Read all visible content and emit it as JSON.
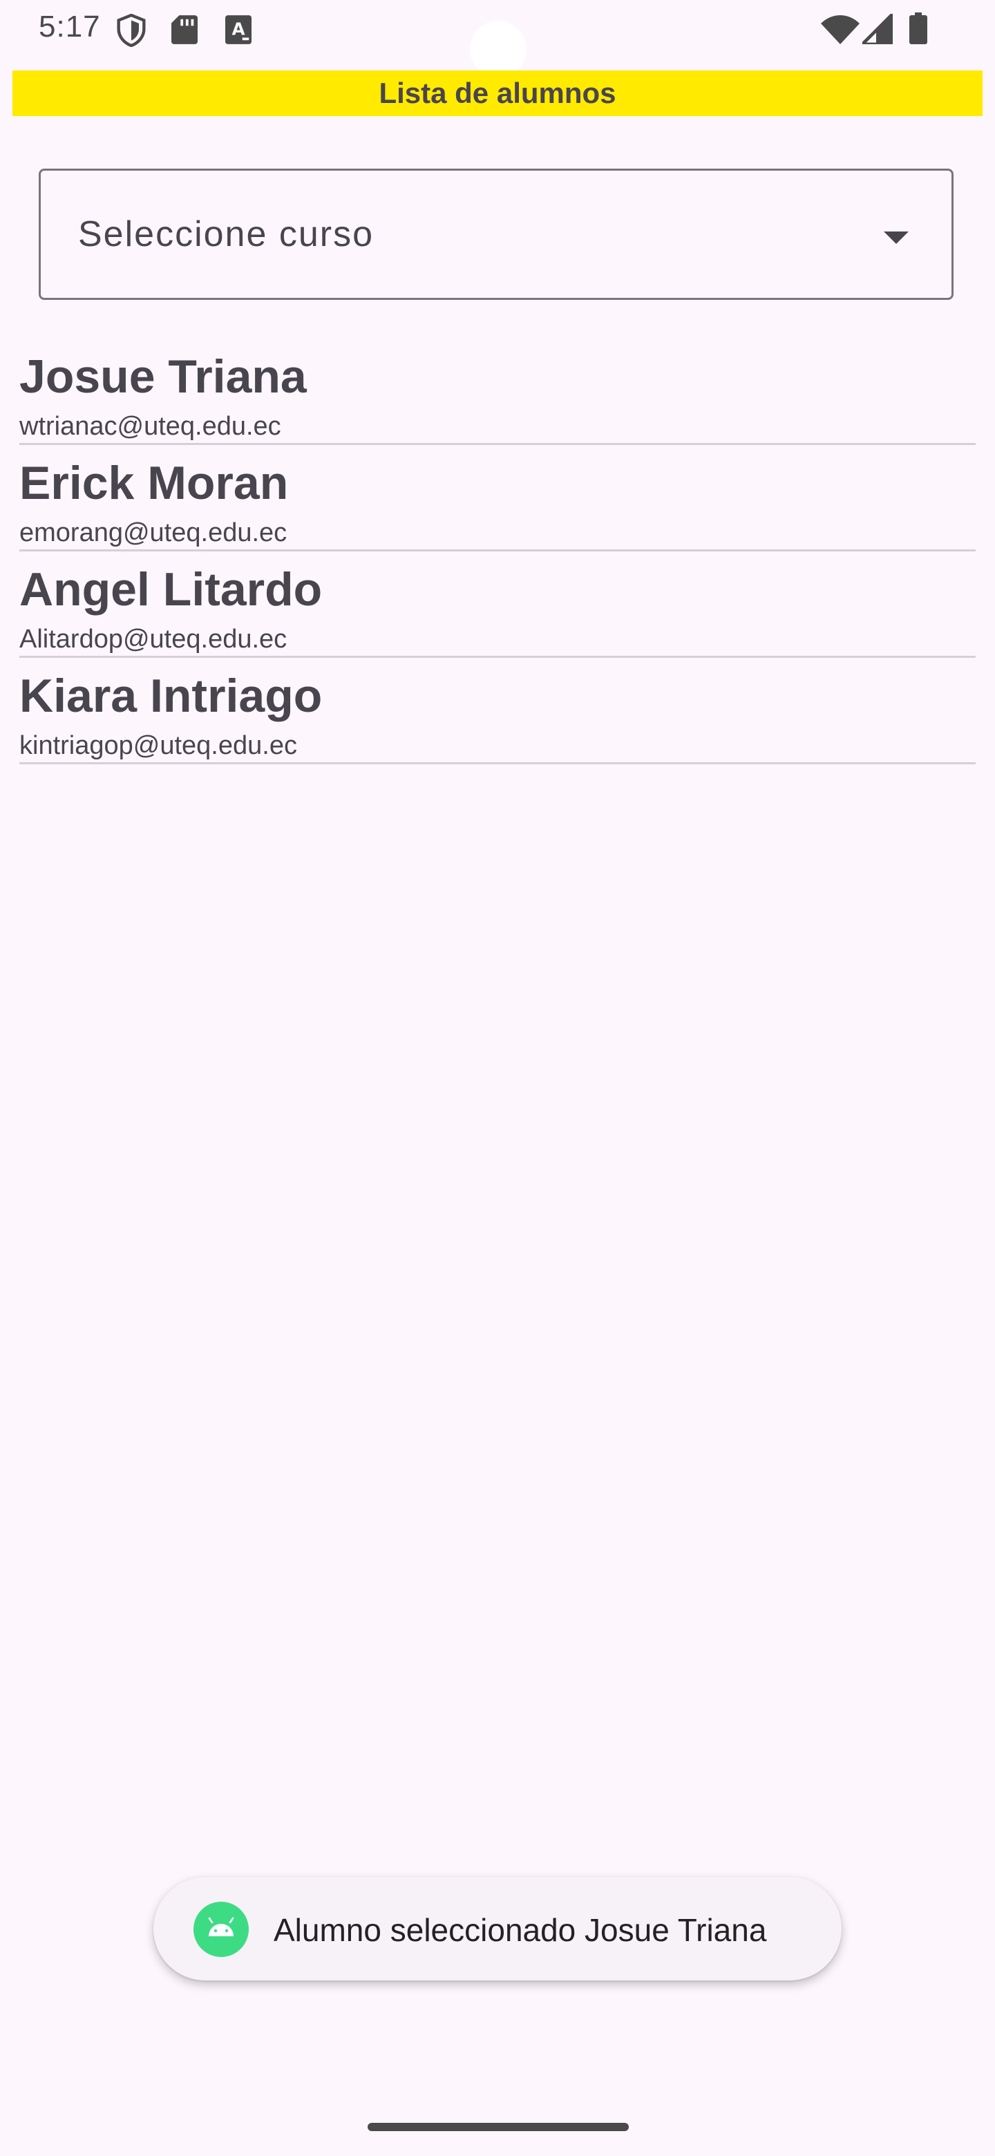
{
  "status_bar": {
    "time": "5:17",
    "left_icons": [
      "shield-icon",
      "sd-card-icon",
      "a-text-icon"
    ],
    "right_icons": [
      "wifi-icon",
      "signal-icon",
      "battery-icon"
    ]
  },
  "header": {
    "title": "Lista de alumnos",
    "background_color": "#ffea00"
  },
  "course_select": {
    "label": "Seleccione curso"
  },
  "students": [
    {
      "name": "Josue Triana",
      "email": "wtrianac@uteq.edu.ec"
    },
    {
      "name": "Erick Moran",
      "email": "emorang@uteq.edu.ec"
    },
    {
      "name": "Angel Litardo",
      "email": "Alitardop@uteq.edu.ec"
    },
    {
      "name": "Kiara Intriago",
      "email": "kintriagop@uteq.edu.ec"
    }
  ],
  "toast": {
    "message": "Alumno seleccionado Josue Triana",
    "icon": "android-icon"
  }
}
